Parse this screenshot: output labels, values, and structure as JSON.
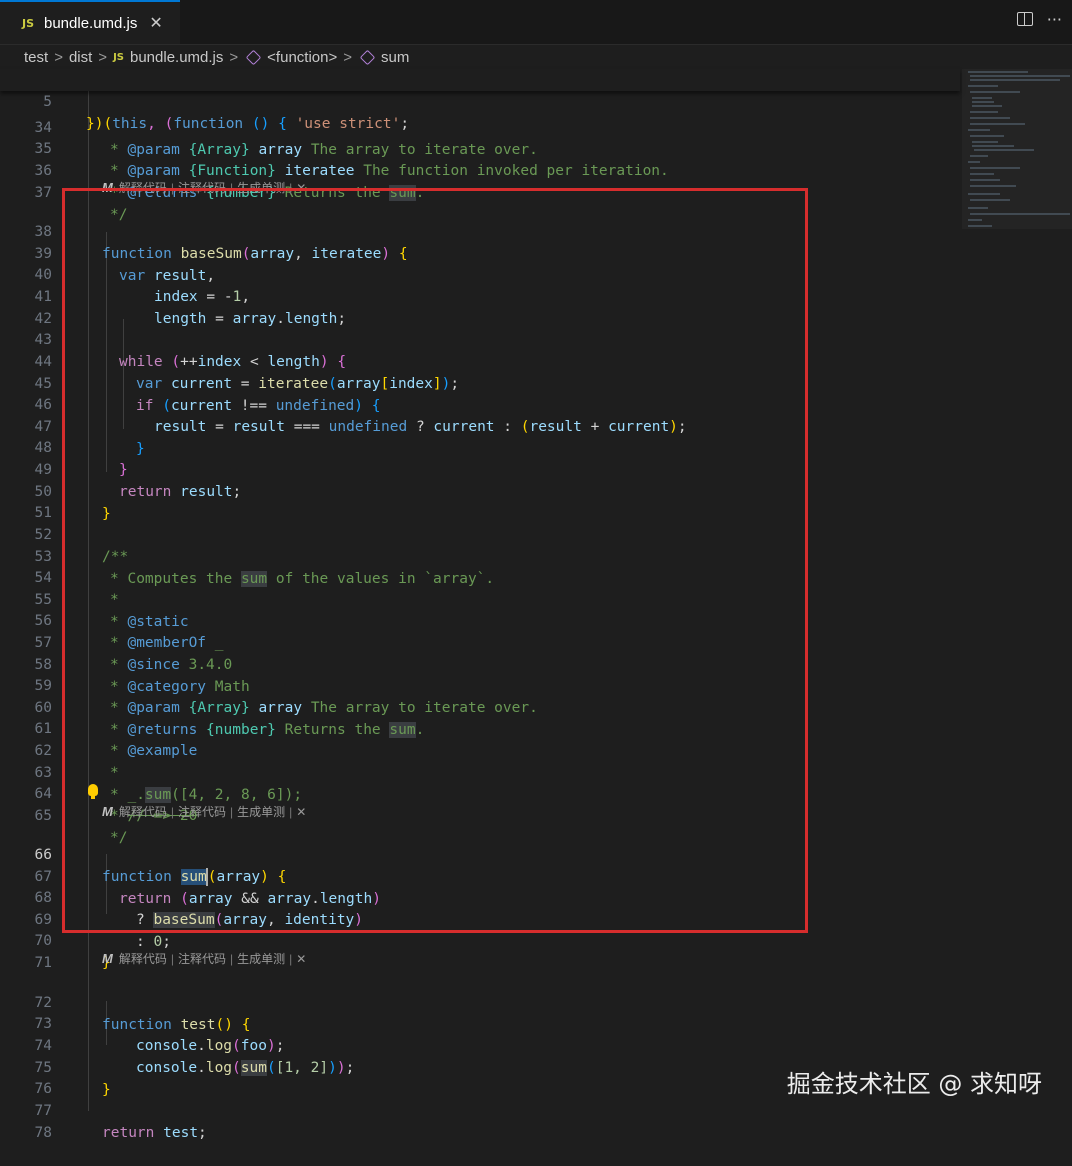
{
  "tab": {
    "badge": "JS",
    "title": "bundle.umd.js",
    "close": "✕"
  },
  "actions": {
    "more": "···"
  },
  "breadcrumb": {
    "items": [
      "test",
      "dist",
      "bundle.umd.js",
      "<function>",
      "sum"
    ],
    "sep": ">",
    "badge": "JS"
  },
  "lens": {
    "explain": "解释代码",
    "comment": "注释代码",
    "test": "生成单测",
    "close": "✕",
    "sep": "|"
  },
  "line_numbers": [
    "5",
    "34",
    "35",
    "36",
    "37",
    "38",
    "39",
    "40",
    "41",
    "42",
    "43",
    "44",
    "45",
    "46",
    "47",
    "48",
    "49",
    "50",
    "51",
    "52",
    "53",
    "54",
    "55",
    "56",
    "57",
    "58",
    "59",
    "60",
    "61",
    "62",
    "63",
    "64",
    "65",
    "66",
    "67",
    "68",
    "69",
    "70",
    "71",
    "72",
    "73",
    "74",
    "75",
    "76",
    "77",
    "78"
  ],
  "code": {
    "l5": {
      "a": "})(",
      "b": "this",
      "c": ", (",
      "d": "function",
      "e": " () { ",
      "f": "'use strict'",
      "g": ";"
    },
    "l34": {
      "a": "* ",
      "tag": "@param",
      "type": "{Array}",
      "name": "array",
      "rest": " The array to iterate over."
    },
    "l35": {
      "a": "* ",
      "tag": "@param",
      "type": "{Function}",
      "name": "iteratee",
      "rest": " The function invoked per iteration."
    },
    "l36": {
      "a": "* ",
      "tag": "@returns",
      "type": "{number}",
      "rest": " Returns the ",
      "hl": "sum",
      "end": "."
    },
    "l37": "*/",
    "l38": {
      "kw": "function",
      "name": "baseSum",
      "p1": "(",
      "args": "array",
      "c": ", ",
      "args2": "iteratee",
      "p2": ")",
      "br": "{"
    },
    "l39": {
      "kw": "var",
      "v": "result",
      "c": ","
    },
    "l40": {
      "v": "index",
      "op": " = -",
      "n": "1",
      "c": ","
    },
    "l41": {
      "v": "length",
      "op": " = ",
      "v2": "array",
      "d": ".",
      "v3": "length",
      "c": ";"
    },
    "l43": {
      "kw": "while",
      "p1": "(",
      "op": "++",
      "v": "index",
      "op2": " < ",
      "v2": "length",
      "p2": ")",
      "br": "{"
    },
    "l44": {
      "kw": "var",
      "v": "current",
      "op": " = ",
      "fn": "iteratee",
      "p1": "(",
      "v2": "array",
      "b1": "[",
      "v3": "index",
      "b2": "]",
      "p2": ")",
      "c": ";"
    },
    "l45": {
      "kw": "if",
      "p1": "(",
      "v": "current",
      "op": " !== ",
      "k2": "undefined",
      "p2": ")",
      "br": "{"
    },
    "l46": {
      "v": "result",
      "op": " = ",
      "v2": "result",
      "op2": " === ",
      "k2": "undefined",
      "op3": " ? ",
      "v3": "current",
      "op4": " : ",
      "p1": "(",
      "v4": "result",
      "op5": " + ",
      "v5": "current",
      "p2": ")",
      "c": ";"
    },
    "l47": "}",
    "l48": "}",
    "l49": {
      "kw": "return",
      "v": "result",
      "c": ";"
    },
    "l50": "}",
    "l52": "/**",
    "l53": {
      "a": "* Computes the ",
      "hl": "sum",
      "b": " of the values in `array`."
    },
    "l54": "*",
    "l55": {
      "a": "* ",
      "tag": "@static"
    },
    "l56": {
      "a": "* ",
      "tag": "@memberOf",
      "rest": " _"
    },
    "l57": {
      "a": "* ",
      "tag": "@since",
      "rest": " 3.4.0"
    },
    "l58": {
      "a": "* ",
      "tag": "@category",
      "rest": " Math"
    },
    "l59": {
      "a": "* ",
      "tag": "@param",
      "type": "{Array}",
      "name": "array",
      "rest": " The array to iterate over."
    },
    "l60": {
      "a": "* ",
      "tag": "@returns",
      "type": "{number}",
      "rest": " Returns the ",
      "hl": "sum",
      "end": "."
    },
    "l61": {
      "a": "* ",
      "tag": "@example"
    },
    "l62": "*",
    "l63": {
      "a": "* _.",
      "hl": "sum",
      "b": "([4, 2, 8, 6]);"
    },
    "l64": {
      "a": "* ",
      "strike": "// => 20"
    },
    "l65": "*/",
    "l66": {
      "kw": "function",
      "name": "sum",
      "p1": "(",
      "args": "array",
      "p2": ")",
      "br": "{"
    },
    "l67": {
      "kw": "return",
      "p1": "(",
      "v": "array",
      "op": " && ",
      "v2": "array",
      "d": ".",
      "v3": "length",
      "p2": ")"
    },
    "l68": {
      "op": "? ",
      "fn": "baseSum",
      "p1": "(",
      "v": "array",
      "c": ", ",
      "v2": "identity",
      "p2": ")"
    },
    "l69": {
      "op": ": ",
      "n": "0",
      "c": ";"
    },
    "l70": "}",
    "l72": {
      "kw": "function",
      "name": "test",
      "p": "()",
      "br": "{"
    },
    "l73": {
      "v": "console",
      "d": ".",
      "fn": "log",
      "p1": "(",
      "v2": "foo",
      "p2": ")",
      "c": ";"
    },
    "l74": {
      "v": "console",
      "d": ".",
      "fn": "log",
      "p1": "(",
      "fn2": "sum",
      "p3": "(",
      "arr": "[1, 2]",
      "p4": ")",
      "p2": ")",
      "c": ";"
    },
    "l75": "}",
    "l77": {
      "kw": "return",
      "v": "test",
      "c": ";"
    }
  },
  "watermark": "掘金技术社区 @ 求知呀",
  "colors": {
    "highlight_box": "#d62d2d",
    "tab_accent": "#0078d4",
    "background": "#1e1e1e"
  }
}
